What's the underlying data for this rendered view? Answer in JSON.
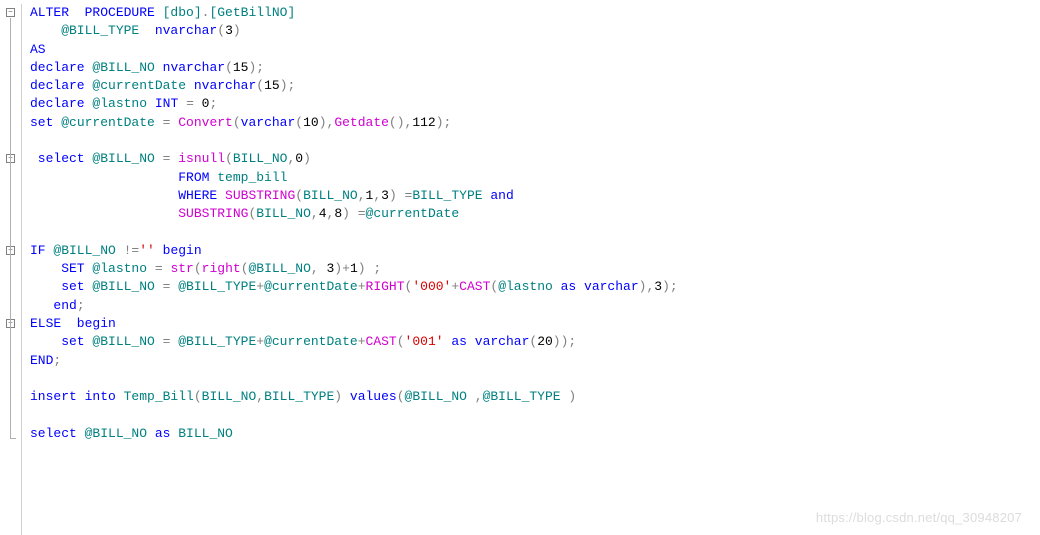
{
  "watermark": "https://blog.csdn.net/qq_30948207",
  "lines": [
    {
      "fold": true,
      "tokens": [
        {
          "t": "ALTER  PROCEDURE ",
          "c": "kw"
        },
        {
          "t": "[dbo]",
          "c": "tl"
        },
        {
          "t": ".",
          "c": "grey"
        },
        {
          "t": "[GetBillNO]",
          "c": "tl"
        }
      ]
    },
    {
      "tokens": [
        {
          "t": "    @BILL_TYPE  ",
          "c": "param"
        },
        {
          "t": "nvarchar",
          "c": "kw"
        },
        {
          "t": "(",
          "c": "grey"
        },
        {
          "t": "3",
          "c": "num"
        },
        {
          "t": ")",
          "c": "grey"
        }
      ]
    },
    {
      "tokens": [
        {
          "t": "AS",
          "c": "kw"
        }
      ]
    },
    {
      "tokens": [
        {
          "t": "declare ",
          "c": "kw"
        },
        {
          "t": "@BILL_NO ",
          "c": "param"
        },
        {
          "t": "nvarchar",
          "c": "kw"
        },
        {
          "t": "(",
          "c": "grey"
        },
        {
          "t": "15",
          "c": "num"
        },
        {
          "t": ");",
          "c": "grey"
        }
      ]
    },
    {
      "tokens": [
        {
          "t": "declare ",
          "c": "kw"
        },
        {
          "t": "@currentDate ",
          "c": "param"
        },
        {
          "t": "nvarchar",
          "c": "kw"
        },
        {
          "t": "(",
          "c": "grey"
        },
        {
          "t": "15",
          "c": "num"
        },
        {
          "t": ");",
          "c": "grey"
        }
      ]
    },
    {
      "tokens": [
        {
          "t": "declare ",
          "c": "kw"
        },
        {
          "t": "@lastno ",
          "c": "param"
        },
        {
          "t": "INT ",
          "c": "kw"
        },
        {
          "t": "= ",
          "c": "grey"
        },
        {
          "t": "0",
          "c": "num"
        },
        {
          "t": ";",
          "c": "grey"
        }
      ]
    },
    {
      "tokens": [
        {
          "t": "set ",
          "c": "kw"
        },
        {
          "t": "@currentDate ",
          "c": "param"
        },
        {
          "t": "= ",
          "c": "grey"
        },
        {
          "t": "Convert",
          "c": "fn"
        },
        {
          "t": "(",
          "c": "grey"
        },
        {
          "t": "varchar",
          "c": "kw"
        },
        {
          "t": "(",
          "c": "grey"
        },
        {
          "t": "10",
          "c": "num"
        },
        {
          "t": "),",
          "c": "grey"
        },
        {
          "t": "Getdate",
          "c": "fn"
        },
        {
          "t": "(),",
          "c": "grey"
        },
        {
          "t": "112",
          "c": "num"
        },
        {
          "t": ");",
          "c": "grey"
        }
      ]
    },
    {
      "tokens": [
        {
          "t": " ",
          "c": ""
        }
      ]
    },
    {
      "fold": true,
      "tokens": [
        {
          "t": " select ",
          "c": "kw"
        },
        {
          "t": "@BILL_NO ",
          "c": "param"
        },
        {
          "t": "= ",
          "c": "grey"
        },
        {
          "t": "isnull",
          "c": "fn"
        },
        {
          "t": "(",
          "c": "grey"
        },
        {
          "t": "BILL_NO",
          "c": "tl"
        },
        {
          "t": ",",
          "c": "grey"
        },
        {
          "t": "0",
          "c": "num"
        },
        {
          "t": ")",
          "c": "grey"
        }
      ]
    },
    {
      "tokens": [
        {
          "t": "                   FROM ",
          "c": "kw"
        },
        {
          "t": "temp_bill",
          "c": "tl"
        }
      ]
    },
    {
      "tokens": [
        {
          "t": "                   WHERE ",
          "c": "kw"
        },
        {
          "t": "SUBSTRING",
          "c": "fn"
        },
        {
          "t": "(",
          "c": "grey"
        },
        {
          "t": "BILL_NO",
          "c": "tl"
        },
        {
          "t": ",",
          "c": "grey"
        },
        {
          "t": "1",
          "c": "num"
        },
        {
          "t": ",",
          "c": "grey"
        },
        {
          "t": "3",
          "c": "num"
        },
        {
          "t": ") =",
          "c": "grey"
        },
        {
          "t": "BILL_TYPE ",
          "c": "tl"
        },
        {
          "t": "and",
          "c": "kw"
        }
      ]
    },
    {
      "tokens": [
        {
          "t": "                   ",
          "c": ""
        },
        {
          "t": "SUBSTRING",
          "c": "fn"
        },
        {
          "t": "(",
          "c": "grey"
        },
        {
          "t": "BILL_NO",
          "c": "tl"
        },
        {
          "t": ",",
          "c": "grey"
        },
        {
          "t": "4",
          "c": "num"
        },
        {
          "t": ",",
          "c": "grey"
        },
        {
          "t": "8",
          "c": "num"
        },
        {
          "t": ") =",
          "c": "grey"
        },
        {
          "t": "@currentDate",
          "c": "param"
        }
      ]
    },
    {
      "tokens": [
        {
          "t": " ",
          "c": ""
        }
      ]
    },
    {
      "fold": true,
      "tokens": [
        {
          "t": "IF ",
          "c": "kw"
        },
        {
          "t": "@BILL_NO ",
          "c": "param"
        },
        {
          "t": "!=",
          "c": "grey"
        },
        {
          "t": "'' ",
          "c": "str"
        },
        {
          "t": "begin",
          "c": "kw"
        }
      ]
    },
    {
      "tokens": [
        {
          "t": "    SET ",
          "c": "kw"
        },
        {
          "t": "@lastno ",
          "c": "param"
        },
        {
          "t": "= ",
          "c": "grey"
        },
        {
          "t": "str",
          "c": "fn"
        },
        {
          "t": "(",
          "c": "grey"
        },
        {
          "t": "right",
          "c": "fn"
        },
        {
          "t": "(",
          "c": "grey"
        },
        {
          "t": "@BILL_NO",
          "c": "param"
        },
        {
          "t": ", ",
          "c": "grey"
        },
        {
          "t": "3",
          "c": "num"
        },
        {
          "t": ")+",
          "c": "grey"
        },
        {
          "t": "1",
          "c": "num"
        },
        {
          "t": ") ;",
          "c": "grey"
        }
      ]
    },
    {
      "tokens": [
        {
          "t": "    set ",
          "c": "kw"
        },
        {
          "t": "@BILL_NO ",
          "c": "param"
        },
        {
          "t": "= ",
          "c": "grey"
        },
        {
          "t": "@BILL_TYPE",
          "c": "param"
        },
        {
          "t": "+",
          "c": "grey"
        },
        {
          "t": "@currentDate",
          "c": "param"
        },
        {
          "t": "+",
          "c": "grey"
        },
        {
          "t": "RIGHT",
          "c": "fn"
        },
        {
          "t": "(",
          "c": "grey"
        },
        {
          "t": "'000'",
          "c": "str"
        },
        {
          "t": "+",
          "c": "grey"
        },
        {
          "t": "CAST",
          "c": "fn"
        },
        {
          "t": "(",
          "c": "grey"
        },
        {
          "t": "@lastno ",
          "c": "param"
        },
        {
          "t": "as ",
          "c": "kw"
        },
        {
          "t": "varchar",
          "c": "kw"
        },
        {
          "t": "),",
          "c": "grey"
        },
        {
          "t": "3",
          "c": "num"
        },
        {
          "t": ");",
          "c": "grey"
        }
      ]
    },
    {
      "tokens": [
        {
          "t": "   end",
          "c": "kw"
        },
        {
          "t": ";",
          "c": "grey"
        }
      ]
    },
    {
      "fold": true,
      "tokens": [
        {
          "t": "ELSE  begin",
          "c": "kw"
        }
      ]
    },
    {
      "tokens": [
        {
          "t": "    set ",
          "c": "kw"
        },
        {
          "t": "@BILL_NO ",
          "c": "param"
        },
        {
          "t": "= ",
          "c": "grey"
        },
        {
          "t": "@BILL_TYPE",
          "c": "param"
        },
        {
          "t": "+",
          "c": "grey"
        },
        {
          "t": "@currentDate",
          "c": "param"
        },
        {
          "t": "+",
          "c": "grey"
        },
        {
          "t": "CAST",
          "c": "fn"
        },
        {
          "t": "(",
          "c": "grey"
        },
        {
          "t": "'001' ",
          "c": "str"
        },
        {
          "t": "as ",
          "c": "kw"
        },
        {
          "t": "varchar",
          "c": "kw"
        },
        {
          "t": "(",
          "c": "grey"
        },
        {
          "t": "20",
          "c": "num"
        },
        {
          "t": "));",
          "c": "grey"
        }
      ]
    },
    {
      "tokens": [
        {
          "t": "END",
          "c": "kw"
        },
        {
          "t": ";",
          "c": "grey"
        }
      ]
    },
    {
      "tokens": [
        {
          "t": " ",
          "c": ""
        }
      ]
    },
    {
      "tokens": [
        {
          "t": "insert into ",
          "c": "kw"
        },
        {
          "t": "Temp_Bill",
          "c": "tl"
        },
        {
          "t": "(",
          "c": "grey"
        },
        {
          "t": "BILL_NO",
          "c": "tl"
        },
        {
          "t": ",",
          "c": "grey"
        },
        {
          "t": "BILL_TYPE",
          "c": "tl"
        },
        {
          "t": ") ",
          "c": "grey"
        },
        {
          "t": "values",
          "c": "kw"
        },
        {
          "t": "(",
          "c": "grey"
        },
        {
          "t": "@BILL_NO ",
          "c": "param"
        },
        {
          "t": ",",
          "c": "grey"
        },
        {
          "t": "@BILL_TYPE ",
          "c": "param"
        },
        {
          "t": ")",
          "c": "grey"
        }
      ]
    },
    {
      "tokens": [
        {
          "t": " ",
          "c": ""
        }
      ]
    },
    {
      "tokens": [
        {
          "t": "select ",
          "c": "kw"
        },
        {
          "t": "@BILL_NO ",
          "c": "param"
        },
        {
          "t": "as ",
          "c": "kw"
        },
        {
          "t": "BILL_NO",
          "c": "tl"
        }
      ]
    }
  ]
}
